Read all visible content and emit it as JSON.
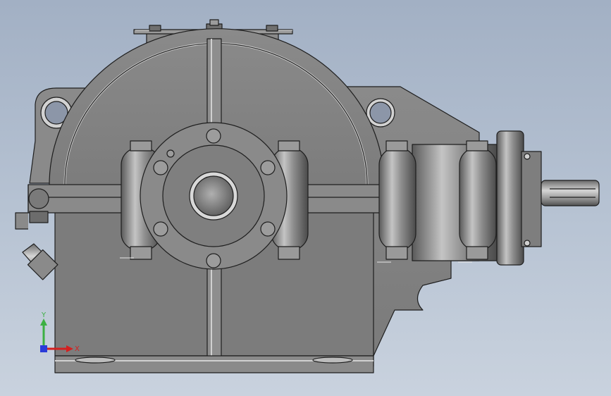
{
  "viewport": {
    "background_top": "#a2b0c4",
    "background_bottom": "#c9d2de"
  },
  "triad": {
    "y_label": "Y",
    "x_label": "X",
    "y_color": "#3cb043",
    "x_color": "#d42020",
    "z_color": "#2a3bd8"
  },
  "model": {
    "body_color": "#828282",
    "edge_color": "#1e1e1e",
    "highlight_color": "#cfcfcf"
  }
}
